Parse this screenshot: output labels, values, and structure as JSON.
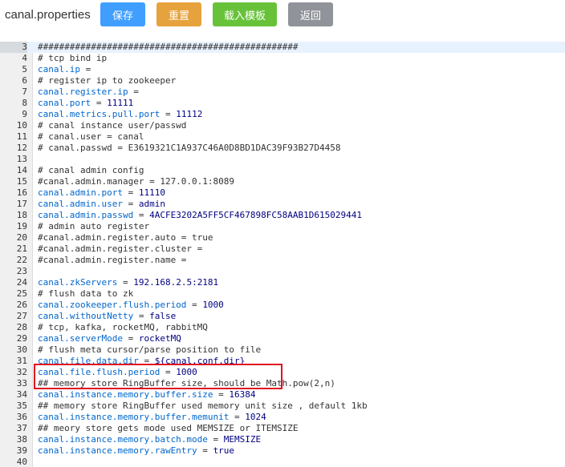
{
  "header": {
    "title": "canal.properties",
    "buttons": {
      "save": "保存",
      "reset": "重置",
      "load_template": "载入模板",
      "back": "返回"
    }
  },
  "colors": {
    "save": "#409eff",
    "reset": "#e6a23c",
    "load_template": "#67c23a",
    "back": "#909399",
    "highlight_box": "#e0131f"
  },
  "editor": {
    "highlight_lines": [
      28,
      29
    ],
    "lines": [
      {
        "n": 3,
        "t": "comment",
        "text": "#################################################"
      },
      {
        "n": 4,
        "t": "comment",
        "text": "# tcp bind ip"
      },
      {
        "n": 5,
        "t": "kv",
        "key": "canal.ip",
        "value": ""
      },
      {
        "n": 6,
        "t": "comment",
        "text": "# register ip to zookeeper"
      },
      {
        "n": 7,
        "t": "kv",
        "key": "canal.register.ip",
        "value": ""
      },
      {
        "n": 8,
        "t": "kv",
        "key": "canal.port",
        "value": "11111"
      },
      {
        "n": 9,
        "t": "kv",
        "key": "canal.metrics.pull.port",
        "value": "11112"
      },
      {
        "n": 10,
        "t": "comment",
        "text": "# canal instance user/passwd"
      },
      {
        "n": 11,
        "t": "comment",
        "text": "# canal.user = canal"
      },
      {
        "n": 12,
        "t": "comment",
        "text": "# canal.passwd = E3619321C1A937C46A0D8BD1DAC39F93B27D4458"
      },
      {
        "n": 13,
        "t": "blank",
        "text": ""
      },
      {
        "n": 14,
        "t": "comment",
        "text": "# canal admin config"
      },
      {
        "n": 15,
        "t": "comment",
        "text": "#canal.admin.manager = 127.0.0.1:8089"
      },
      {
        "n": 16,
        "t": "kv",
        "key": "canal.admin.port",
        "value": "11110"
      },
      {
        "n": 17,
        "t": "kv",
        "key": "canal.admin.user",
        "value": "admin"
      },
      {
        "n": 18,
        "t": "kv",
        "key": "canal.admin.passwd",
        "value": "4ACFE3202A5FF5CF467898FC58AAB1D615029441"
      },
      {
        "n": 19,
        "t": "comment",
        "text": "# admin auto register"
      },
      {
        "n": 20,
        "t": "comment",
        "text": "#canal.admin.register.auto = true"
      },
      {
        "n": 21,
        "t": "comment",
        "text": "#canal.admin.register.cluster ="
      },
      {
        "n": 22,
        "t": "comment",
        "text": "#canal.admin.register.name ="
      },
      {
        "n": 23,
        "t": "blank",
        "text": ""
      },
      {
        "n": 24,
        "t": "kv",
        "key": "canal.zkServers",
        "value": "192.168.2.5:2181"
      },
      {
        "n": 25,
        "t": "comment",
        "text": "# flush data to zk"
      },
      {
        "n": 26,
        "t": "kv",
        "key": "canal.zookeeper.flush.period",
        "value": "1000"
      },
      {
        "n": 27,
        "t": "kv",
        "key": "canal.withoutNetty",
        "value": "false"
      },
      {
        "n": 28,
        "t": "comment",
        "text": "# tcp, kafka, rocketMQ, rabbitMQ"
      },
      {
        "n": 29,
        "t": "kv",
        "key": "canal.serverMode",
        "value": "rocketMQ"
      },
      {
        "n": 30,
        "t": "comment",
        "text": "# flush meta cursor/parse position to file"
      },
      {
        "n": 31,
        "t": "kv",
        "key": "canal.file.data.dir",
        "value": "${canal.conf.dir}"
      },
      {
        "n": 32,
        "t": "kv",
        "key": "canal.file.flush.period",
        "value": "1000"
      },
      {
        "n": 33,
        "t": "comment",
        "text": "## memory store RingBuffer size, should be Math.pow(2,n)"
      },
      {
        "n": 34,
        "t": "kv",
        "key": "canal.instance.memory.buffer.size",
        "value": "16384"
      },
      {
        "n": 35,
        "t": "comment",
        "text": "## memory store RingBuffer used memory unit size , default 1kb"
      },
      {
        "n": 36,
        "t": "kv",
        "key": "canal.instance.memory.buffer.memunit",
        "value": "1024"
      },
      {
        "n": 37,
        "t": "comment",
        "text": "## meory store gets mode used MEMSIZE or ITEMSIZE"
      },
      {
        "n": 38,
        "t": "kv",
        "key": "canal.instance.memory.batch.mode",
        "value": "MEMSIZE"
      },
      {
        "n": 39,
        "t": "kv",
        "key": "canal.instance.memory.rawEntry",
        "value": "true"
      },
      {
        "n": 40,
        "t": "blank",
        "text": ""
      }
    ]
  }
}
